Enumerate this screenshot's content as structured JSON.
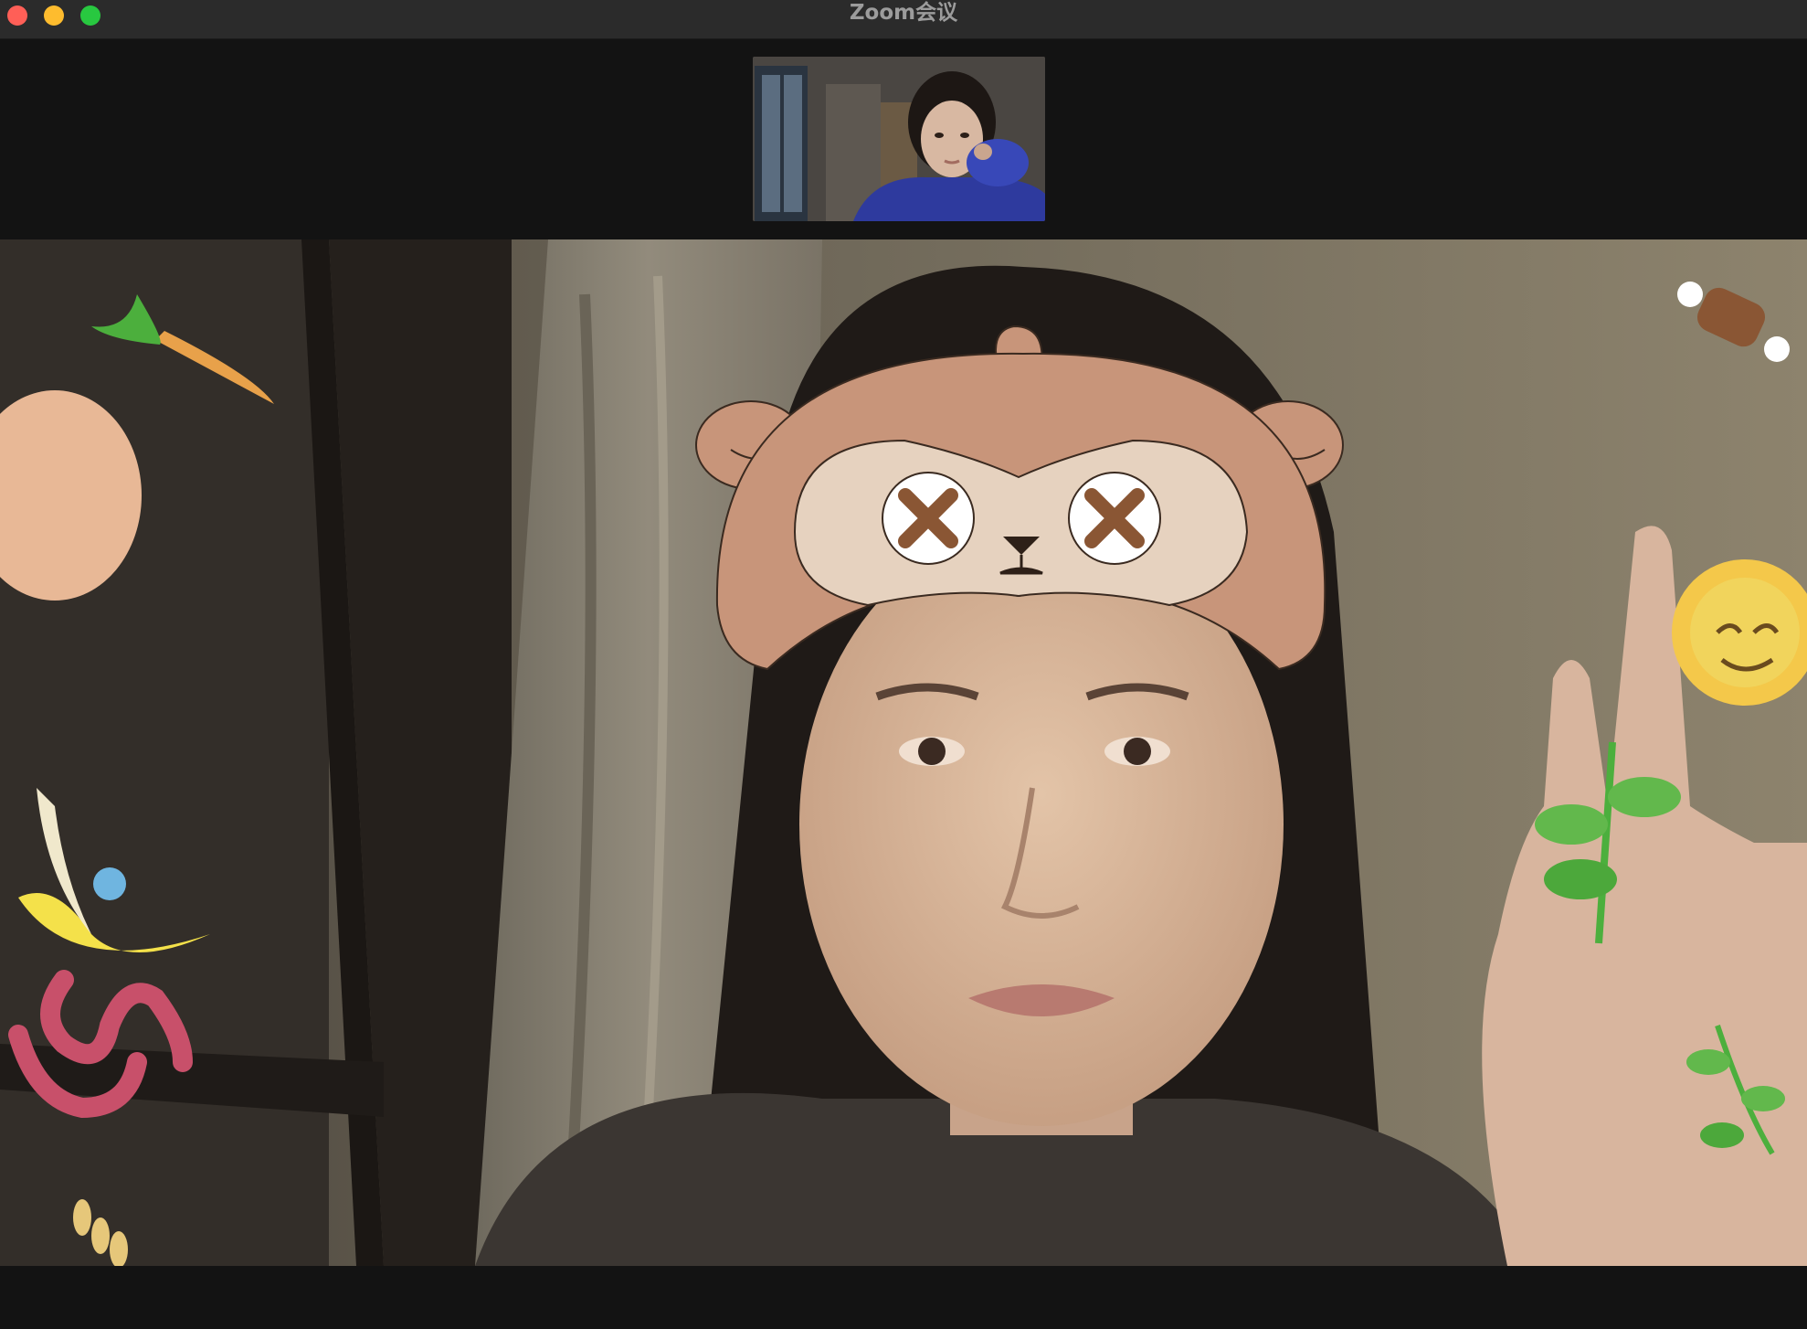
{
  "window": {
    "title": "Zoom会议",
    "traffic_lights": [
      "close",
      "minimize",
      "maximize"
    ],
    "colors": {
      "close": "#ff5f57",
      "minimize": "#febc2e",
      "maximize": "#28c840"
    }
  },
  "thumbnail": {
    "type": "self-view",
    "content": "participant-video"
  },
  "main_video": {
    "type": "active-speaker-video",
    "filter": "monkey-mask-face-filter",
    "stickers": [
      "carrot-icon",
      "egg-icon",
      "banana-icon",
      "worm-icon",
      "wheat-icon",
      "meat-bone-icon",
      "sun-icon",
      "sprout-icon",
      "leaf-branch-icon"
    ]
  }
}
